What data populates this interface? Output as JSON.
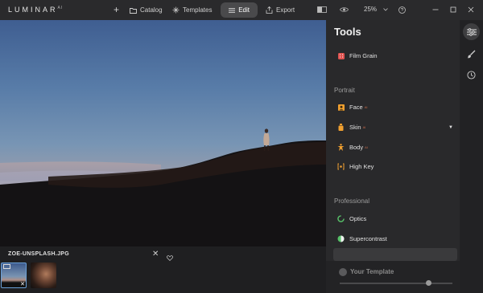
{
  "app": {
    "logo_text": "LUMINAR",
    "logo_sup": "AI"
  },
  "toolbar": {
    "add_label": "+",
    "catalog_label": "Catalog",
    "templates_label": "Templates",
    "edit_label": "Edit",
    "export_label": "Export",
    "zoom_label": "25%",
    "active_tab": "Edit"
  },
  "icons": {
    "add": "plus-icon",
    "catalog": "folder-icon",
    "templates": "sparkle-icon",
    "edit": "sliders-icon",
    "export": "share-icon",
    "compare": "compare-icon",
    "preview": "eye-icon",
    "zoom_dropdown": "chevron-down-icon",
    "help": "help-icon",
    "minimize": "minimize-icon",
    "maximize": "maximize-icon",
    "close": "close-icon",
    "rail_tools": "sliders-icon",
    "rail_brush": "brush-icon",
    "rail_history": "clock-icon"
  },
  "filmstrip": {
    "filename": "ZOE-UNSPLASH.JPG",
    "close_label": "✕",
    "thumb_close_label": "✕"
  },
  "panel": {
    "title": "Tools",
    "tools_top": [
      {
        "label": "Film Grain",
        "icon": "film-grain-icon",
        "color": "#e0524f"
      }
    ],
    "portrait_section": "Portrait",
    "portrait_tools": [
      {
        "label": "Face",
        "ai": "AI",
        "icon": "face-icon",
        "color": "#f0a030"
      },
      {
        "label": "Skin",
        "ai": "AI",
        "icon": "skin-icon",
        "color": "#f0a030"
      },
      {
        "label": "Body",
        "ai": "AI",
        "icon": "body-icon",
        "color": "#f0a030"
      },
      {
        "label": "High Key",
        "ai": "",
        "icon": "high-key-icon",
        "color": "#f0a030"
      }
    ],
    "professional_section": "Professional",
    "professional_tools": [
      {
        "label": "Optics",
        "icon": "optics-icon",
        "color": "#58c46a"
      },
      {
        "label": "Supercontrast",
        "icon": "supercontrast-icon",
        "color": "#58c46a"
      }
    ],
    "template_label": "Your Template",
    "template_slider_value": 0.8
  }
}
